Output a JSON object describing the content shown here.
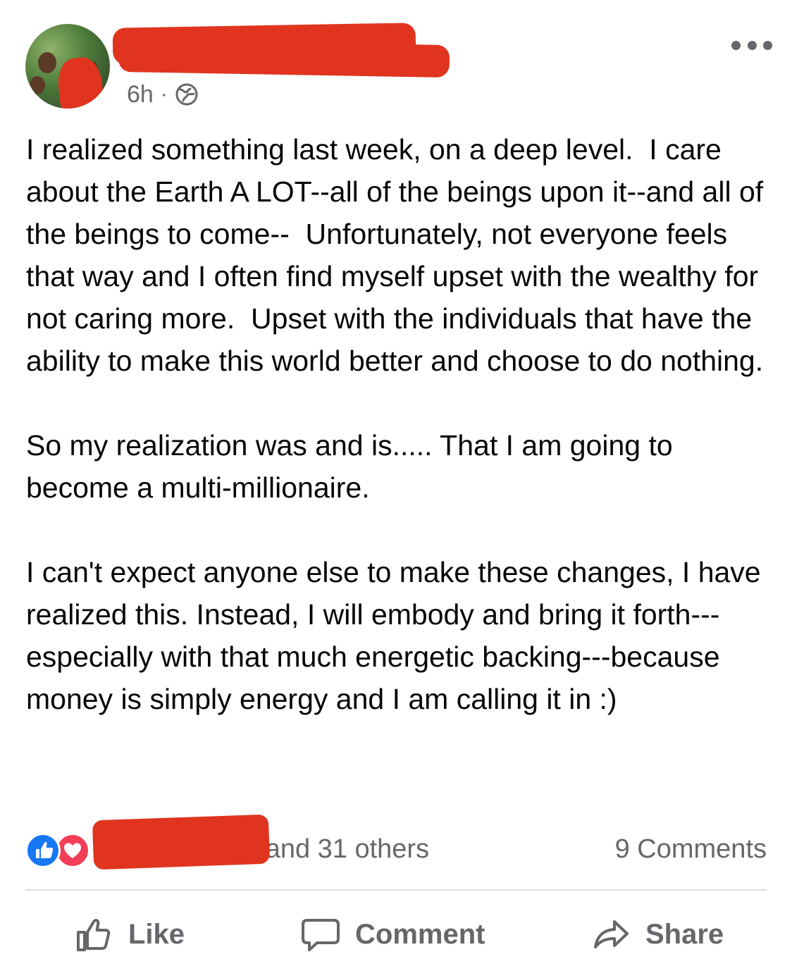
{
  "post": {
    "timestamp": "6h",
    "separator": "·",
    "paragraphs": [
      "I realized something last week, on a deep level.  I care about the Earth A LOT--all of the beings upon it--and all of the beings to come--  Unfortunately, not everyone feels that way and I often find myself upset with the wealthy for not caring more.  Upset with the individuals that have the ability to make this world better and choose to do nothing.",
      "So my realization was and is..... That I am going to become a multi-millionaire.",
      "I can't expect anyone else to make these changes, I have realized this. Instead, I will embody and bring it forth---especially with that much energetic backing---because money is simply energy and I am calling it in :)"
    ]
  },
  "reactions": {
    "text": "ey and 31 others",
    "comments": "9 Comments"
  },
  "actions": {
    "like": "Like",
    "comment": "Comment",
    "share": "Share"
  },
  "colors": {
    "secondary_text": "#65676b",
    "like_blue": "#1877f2",
    "love_red": "#f33e58",
    "redaction": "#e0341f"
  },
  "icons": {
    "privacy": "globe-icon",
    "menu": "more-icon",
    "like_reaction": "like-reaction-icon",
    "love_reaction": "love-reaction-icon",
    "like_action": "thumbs-up-icon",
    "comment_action": "comment-bubble-icon",
    "share_action": "share-arrow-icon"
  }
}
